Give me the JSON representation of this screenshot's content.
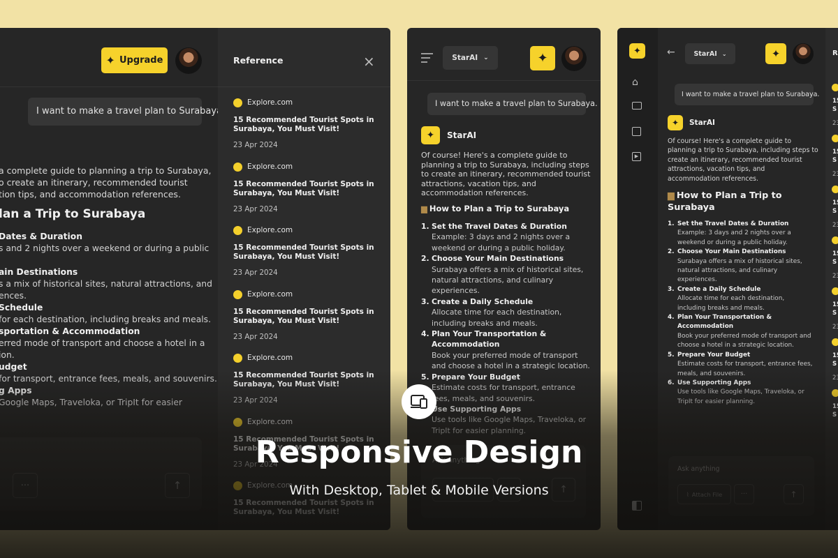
{
  "colors": {
    "accent": "#f6d22b",
    "panel": "#262626",
    "background": "#f2e2a5"
  },
  "desktop": {
    "upgrade_label": "Upgrade",
    "user_message": "I want to make a travel plan to Surabaya.",
    "intro_lines": [
      "a complete guide to planning a trip to Surabaya,",
      "o create an itinerary, recommended tourist",
      "tion tips, and accommodation references."
    ],
    "heading": "lan a Trip to Surabaya",
    "steps": [
      {
        "title": "Dates & Duration",
        "body": [
          "s and 2 nights over a weekend or during a public"
        ]
      },
      {
        "title": "ain Destinations",
        "body": [
          "s a mix of historical sites, natural attractions, and",
          "ences."
        ]
      },
      {
        "title": "Schedule",
        "body": [
          "for each destination, including breaks and meals."
        ]
      },
      {
        "title": "sportation & Accommodation",
        "body": [
          "erred mode of transport and choose a hotel in a",
          "ion."
        ]
      },
      {
        "title": "udget",
        "body": [
          "for transport, entrance fees, meals, and souvenirs."
        ]
      },
      {
        "title": "g Apps",
        "body": [
          "Google Maps, Traveloka, or TripIt for easier"
        ]
      }
    ],
    "more_label": "···",
    "reference": {
      "title": "Reference",
      "items": [
        {
          "source": "Explore.com",
          "title_lines": [
            "15 Recommended Tourist Spots in",
            "Surabaya, You Must Visit!"
          ],
          "date": "23 Apr 2024"
        },
        {
          "source": "Explore.com",
          "title_lines": [
            "15 Recommended Tourist Spots in",
            "Surabaya, You Must Visit!"
          ],
          "date": "23 Apr 2024"
        },
        {
          "source": "Explore.com",
          "title_lines": [
            "15 Recommended Tourist Spots in",
            "Surabaya, You Must Visit!"
          ],
          "date": "23 Apr 2024"
        },
        {
          "source": "Explore.com",
          "title_lines": [
            "15 Recommended Tourist Spots in",
            "Surabaya, You Must Visit!"
          ],
          "date": "23 Apr 2024"
        },
        {
          "source": "Explore.com",
          "title_lines": [
            "15 Recommended Tourist Spots in",
            "Surabaya, You Must Visit!"
          ],
          "date": "23 Apr 2024"
        },
        {
          "source": "Explore.com",
          "title_lines": [
            "15 Recommended Tourist Spots in",
            "Surabaya, You Must Visit!"
          ],
          "date": "23 Apr 2024"
        },
        {
          "source": "Explore.com",
          "title_lines": [
            "15 Recommended Tourist Spots in",
            "Surabaya, You Must Visit!"
          ],
          "date": ""
        }
      ]
    }
  },
  "tablet": {
    "model_select": "StarAI",
    "user_message": "I want to make a travel plan to Surabaya.",
    "bot_name": "StarAI",
    "intro_lines": [
      "Of course! Here's a complete guide to",
      "planning a trip to Surabaya, including steps",
      "to create an itinerary, recommended tourist",
      "attractions, vacation tips, and",
      "accommodation references."
    ],
    "heading": "How to Plan a Trip to Surabaya",
    "steps": [
      {
        "num": "1.",
        "title_lines": [
          "Set the Travel Dates & Duration"
        ],
        "body": [
          "Example: 3 days and 2 nights over a",
          "weekend or during a public holiday."
        ]
      },
      {
        "num": "2.",
        "title_lines": [
          "Choose Your Main Destinations"
        ],
        "body": [
          "Surabaya offers a mix of historical sites,",
          "natural attractions, and culinary",
          "experiences."
        ]
      },
      {
        "num": "3.",
        "title_lines": [
          "Create a Daily Schedule"
        ],
        "body": [
          "Allocate time for each destination,",
          "including breaks and meals."
        ]
      },
      {
        "num": "4.",
        "title_lines": [
          "Plan Your Transportation &",
          "Accommodation"
        ],
        "body": [
          "Book your preferred mode of transport",
          "and choose a hotel in a strategic location."
        ]
      },
      {
        "num": "5.",
        "title_lines": [
          "Prepare Your Budget"
        ],
        "body": [
          "Estimate costs for transport, entrance",
          "fees, meals, and souvenirs."
        ]
      },
      {
        "num": "6.",
        "title_lines": [
          "Use Supporting Apps"
        ],
        "body": [
          "Use tools like Google Maps, Traveloka, or",
          "TripIt for easier planning."
        ]
      }
    ],
    "input_placeholder": "Ask anything"
  },
  "mobile": {
    "model_select": "StarAI",
    "user_message": "I want to make a travel plan to Surabaya.",
    "bot_name": "StarAI",
    "intro_lines": [
      "Of course! Here's a complete guide to",
      "planning a trip to Surabaya, including steps to",
      "create an itinerary, recommended tourist",
      "attractions, vacation tips, and",
      "accommodation references."
    ],
    "heading_lines": [
      "How to Plan a Trip to",
      "Surabaya"
    ],
    "steps": [
      {
        "num": "1.",
        "title_lines": [
          "Set the Travel Dates & Duration"
        ],
        "body": [
          "Example: 3 days and 2 nights over a",
          "weekend or during a public holiday."
        ]
      },
      {
        "num": "2.",
        "title_lines": [
          "Choose Your Main Destinations"
        ],
        "body": [
          "Surabaya offers a mix of historical sites,",
          "natural attractions, and culinary",
          "experiences."
        ]
      },
      {
        "num": "3.",
        "title_lines": [
          "Create a Daily Schedule"
        ],
        "body": [
          "Allocate time for each destination,",
          "including breaks and meals."
        ]
      },
      {
        "num": "4.",
        "title_lines": [
          "Plan Your Transportation &",
          "Accommodation"
        ],
        "body": [
          "Book your preferred mode of transport and",
          "choose a hotel in a strategic location."
        ]
      },
      {
        "num": "5.",
        "title_lines": [
          "Prepare Your Budget"
        ],
        "body": [
          "Estimate costs for transport, entrance fees,",
          "meals, and souvenirs."
        ]
      },
      {
        "num": "6.",
        "title_lines": [
          "Use Supporting Apps"
        ],
        "body": [
          "Use tools like Google Maps, Traveloka, or",
          "TripIt for easier planning."
        ]
      }
    ],
    "input_placeholder": "Ask anything",
    "attach_label": "Attach File",
    "more_label": "···",
    "ref_peek": {
      "title": "Re",
      "lines": [
        "15",
        "S",
        "23",
        "15",
        "S",
        "23",
        "15",
        "S",
        "23",
        "15",
        "S",
        "23",
        "15",
        "S",
        "23",
        "15",
        "S",
        "23",
        "15",
        "S"
      ]
    }
  },
  "hero": {
    "title": "Responsive Design",
    "subtitle": "With Desktop, Tablet & Mobile Versions"
  }
}
